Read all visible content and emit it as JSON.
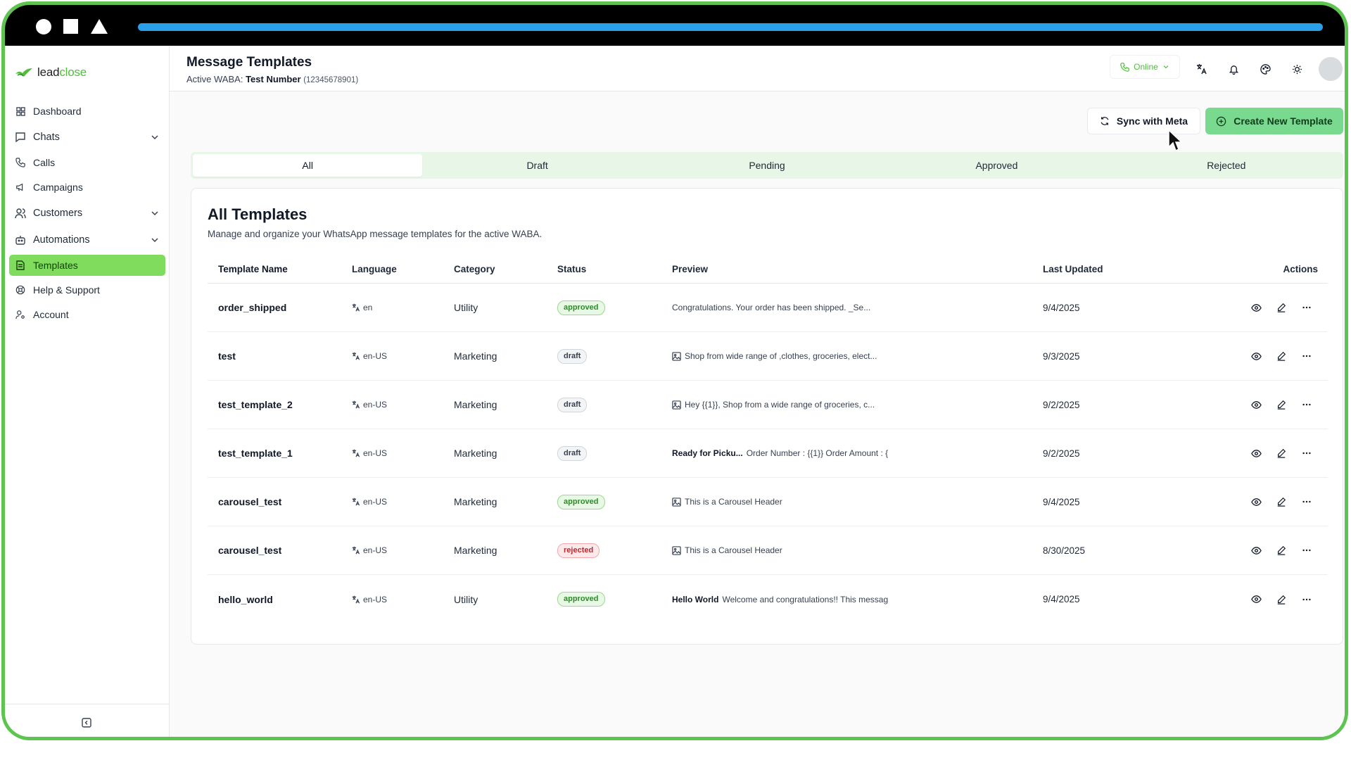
{
  "brand": {
    "name_part1": "lead",
    "name_part2": "close",
    "accent": "#4fbf3a"
  },
  "sidebar": {
    "items": [
      {
        "label": "Dashboard",
        "icon": "dashboard-icon"
      },
      {
        "label": "Chats",
        "icon": "chat-icon",
        "expandable": true
      },
      {
        "label": "Calls",
        "icon": "phone-icon"
      },
      {
        "label": "Campaigns",
        "icon": "megaphone-icon"
      },
      {
        "label": "Customers",
        "icon": "users-icon",
        "expandable": true
      },
      {
        "label": "Automations",
        "icon": "bot-icon",
        "expandable": true
      },
      {
        "label": "Templates",
        "icon": "document-icon",
        "active": true
      },
      {
        "label": "Help & Support",
        "icon": "lifebuoy-icon"
      },
      {
        "label": "Account",
        "icon": "user-key-icon"
      }
    ]
  },
  "header": {
    "title": "Message Templates",
    "waba_label": "Active WABA:",
    "waba_name": "Test Number",
    "waba_number": "(12345678901)",
    "status": "Online"
  },
  "actions": {
    "sync_label": "Sync with Meta",
    "create_label": "Create New Template"
  },
  "tabs": [
    "All",
    "Draft",
    "Pending",
    "Approved",
    "Rejected"
  ],
  "card": {
    "title": "All Templates",
    "subtitle": "Manage and organize your WhatsApp message templates for the active WABA."
  },
  "table": {
    "columns": [
      "Template Name",
      "Language",
      "Category",
      "Status",
      "Preview",
      "Last Updated",
      "Actions"
    ],
    "rows": [
      {
        "name": "order_shipped",
        "language": "en",
        "category": "Utility",
        "status": "approved",
        "preview_bold": "",
        "preview": "Congratulations. Your order has been shipped. _Se...",
        "image": false,
        "updated": "9/4/2025"
      },
      {
        "name": "test",
        "language": "en-US",
        "category": "Marketing",
        "status": "draft",
        "preview_bold": "",
        "preview": "Shop from wide range of ,clothes, groceries, elect...",
        "image": true,
        "updated": "9/3/2025"
      },
      {
        "name": "test_template_2",
        "language": "en-US",
        "category": "Marketing",
        "status": "draft",
        "preview_bold": "",
        "preview": "Hey {{1}}, Shop from a wide range of groceries, c...",
        "image": true,
        "updated": "9/2/2025"
      },
      {
        "name": "test_template_1",
        "language": "en-US",
        "category": "Marketing",
        "status": "draft",
        "preview_bold": "Ready for Picku...",
        "preview": "Order Number : {{1}} Order Amount : {",
        "image": false,
        "updated": "9/2/2025"
      },
      {
        "name": "carousel_test",
        "language": "en-US",
        "category": "Marketing",
        "status": "approved",
        "preview_bold": "",
        "preview": "This is a Carousel Header",
        "image": true,
        "updated": "9/4/2025"
      },
      {
        "name": "carousel_test",
        "language": "en-US",
        "category": "Marketing",
        "status": "rejected",
        "preview_bold": "",
        "preview": "This is a Carousel Header",
        "image": true,
        "updated": "8/30/2025"
      },
      {
        "name": "hello_world",
        "language": "en-US",
        "category": "Utility",
        "status": "approved",
        "preview_bold": "Hello World",
        "preview": "Welcome and congratulations!! This messag",
        "image": false,
        "updated": "9/4/2025"
      }
    ]
  }
}
